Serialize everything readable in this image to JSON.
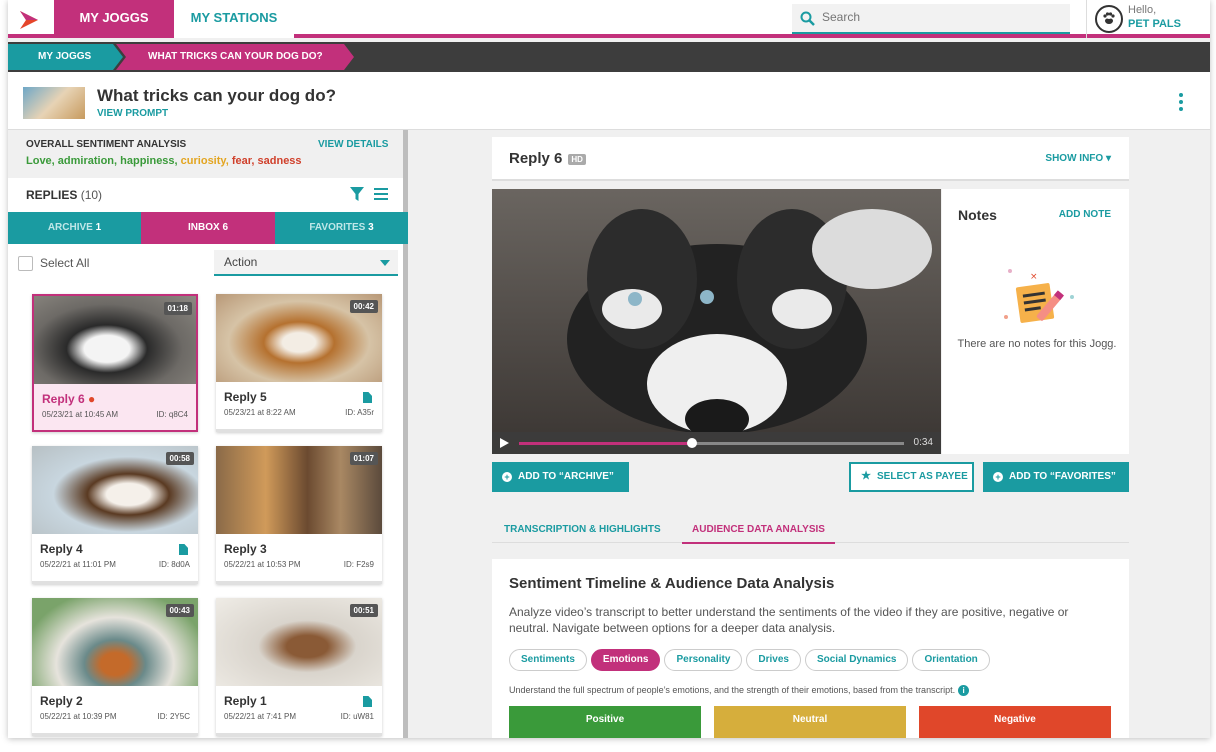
{
  "nav": {
    "tabs": [
      "MY JOGGS",
      "MY STATIONS"
    ]
  },
  "search": {
    "placeholder": "Search"
  },
  "user": {
    "greeting": "Hello,",
    "name": "PET PALS"
  },
  "breadcrumb": [
    "MY JOGGS",
    "WHAT TRICKS CAN YOUR DOG DO?"
  ],
  "prompt": {
    "title": "What tricks can your dog do?",
    "link": "VIEW PROMPT"
  },
  "sentiment": {
    "label": "OVERALL SENTIMENT ANALYSIS",
    "view_details": "VIEW DETAILS",
    "words": [
      {
        "text": "Love, ",
        "color": "#3a9a3a"
      },
      {
        "text": "admiration, ",
        "color": "#3a9a3a"
      },
      {
        "text": "happiness, ",
        "color": "#3a9a3a"
      },
      {
        "text": "curiosity, ",
        "color": "#e3a520"
      },
      {
        "text": "fear, ",
        "color": "#d0402b"
      },
      {
        "text": "sadness",
        "color": "#d0402b"
      }
    ]
  },
  "replies": {
    "label": "REPLIES",
    "count": "(10)"
  },
  "status_tabs": [
    {
      "label": "ARCHIVE",
      "count": "1"
    },
    {
      "label": "INBOX",
      "count": "6"
    },
    {
      "label": "FAVORITES",
      "count": "3"
    }
  ],
  "select_all": "Select All",
  "action": "Action",
  "cards": [
    {
      "name": "Reply 6",
      "date": "05/23/21 at 10:45 AM",
      "id": "ID: q8C4",
      "duration": "01:18",
      "selected": true,
      "doc": false
    },
    {
      "name": "Reply 5",
      "date": "05/23/21 at 8:22 AM",
      "id": "ID: A35r",
      "duration": "00:42",
      "selected": false,
      "doc": true
    },
    {
      "name": "Reply 4",
      "date": "05/22/21 at 11:01 PM",
      "id": "ID: 8d0A",
      "duration": "00:58",
      "selected": false,
      "doc": true
    },
    {
      "name": "Reply 3",
      "date": "05/22/21 at 10:53 PM",
      "id": "ID: F2s9",
      "duration": "01:07",
      "selected": false,
      "doc": false
    },
    {
      "name": "Reply 2",
      "date": "05/22/21 at 10:39 PM",
      "id": "ID: 2Y5C",
      "duration": "00:43",
      "selected": false,
      "doc": false
    },
    {
      "name": "Reply 1",
      "date": "05/22/21 at 7:41 PM",
      "id": "ID: uW81",
      "duration": "00:51",
      "selected": false,
      "doc": true
    }
  ],
  "reply": {
    "title": "Reply 6",
    "badge": "HD",
    "show_info": "SHOW INFO"
  },
  "video": {
    "time": "0:34",
    "progress": 0.45
  },
  "notes": {
    "title": "Notes",
    "add": "ADD NOTE",
    "empty": "There are no notes for this Jogg."
  },
  "actions": {
    "archive": "ADD TO “ARCHIVE”",
    "payee": "SELECT AS PAYEE",
    "favorites": "ADD TO “FAVORITES”"
  },
  "analysis_tabs": [
    "TRANSCRIPTION & HIGHLIGHTS",
    "AUDIENCE DATA ANALYSIS"
  ],
  "analysis": {
    "title": "Sentiment Timeline & Audience Data Analysis",
    "desc": "Analyze video’s transcript to better understand the sentiments of the video if they are positive, negative or neutral. Navigate between options for a deeper data analysis.",
    "options": [
      "Sentiments",
      "Emotions",
      "Personality",
      "Drives",
      "Social Dynamics",
      "Orientation"
    ],
    "active_option": "Emotions",
    "note": "Understand the full spectrum of people’s emotions, and the strength of their emotions, based from the transcript.",
    "bars": [
      {
        "label": "Positive",
        "color": "#3a9a3a"
      },
      {
        "label": "Neutral",
        "color": "#d6ae3c"
      },
      {
        "label": "Negative",
        "color": "#e0472a"
      }
    ]
  },
  "colors": {
    "brand_pink": "#c2307b",
    "brand_teal": "#1a9ba1"
  }
}
